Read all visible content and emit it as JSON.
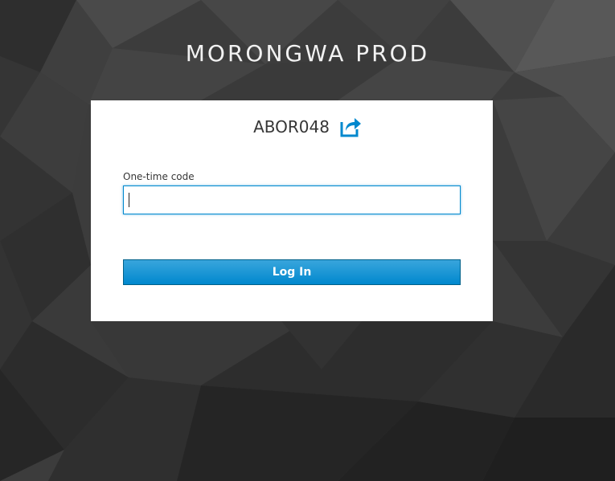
{
  "realm": {
    "title": "MORONGWA PROD"
  },
  "login": {
    "username": "ABOR048",
    "restart_icon": "share-arrow-icon",
    "otp_label": "One-time code",
    "otp_value": "",
    "submit_label": "Log In"
  },
  "colors": {
    "accent": "#0088ce",
    "background": "#3a3a3a",
    "card": "#ffffff"
  }
}
